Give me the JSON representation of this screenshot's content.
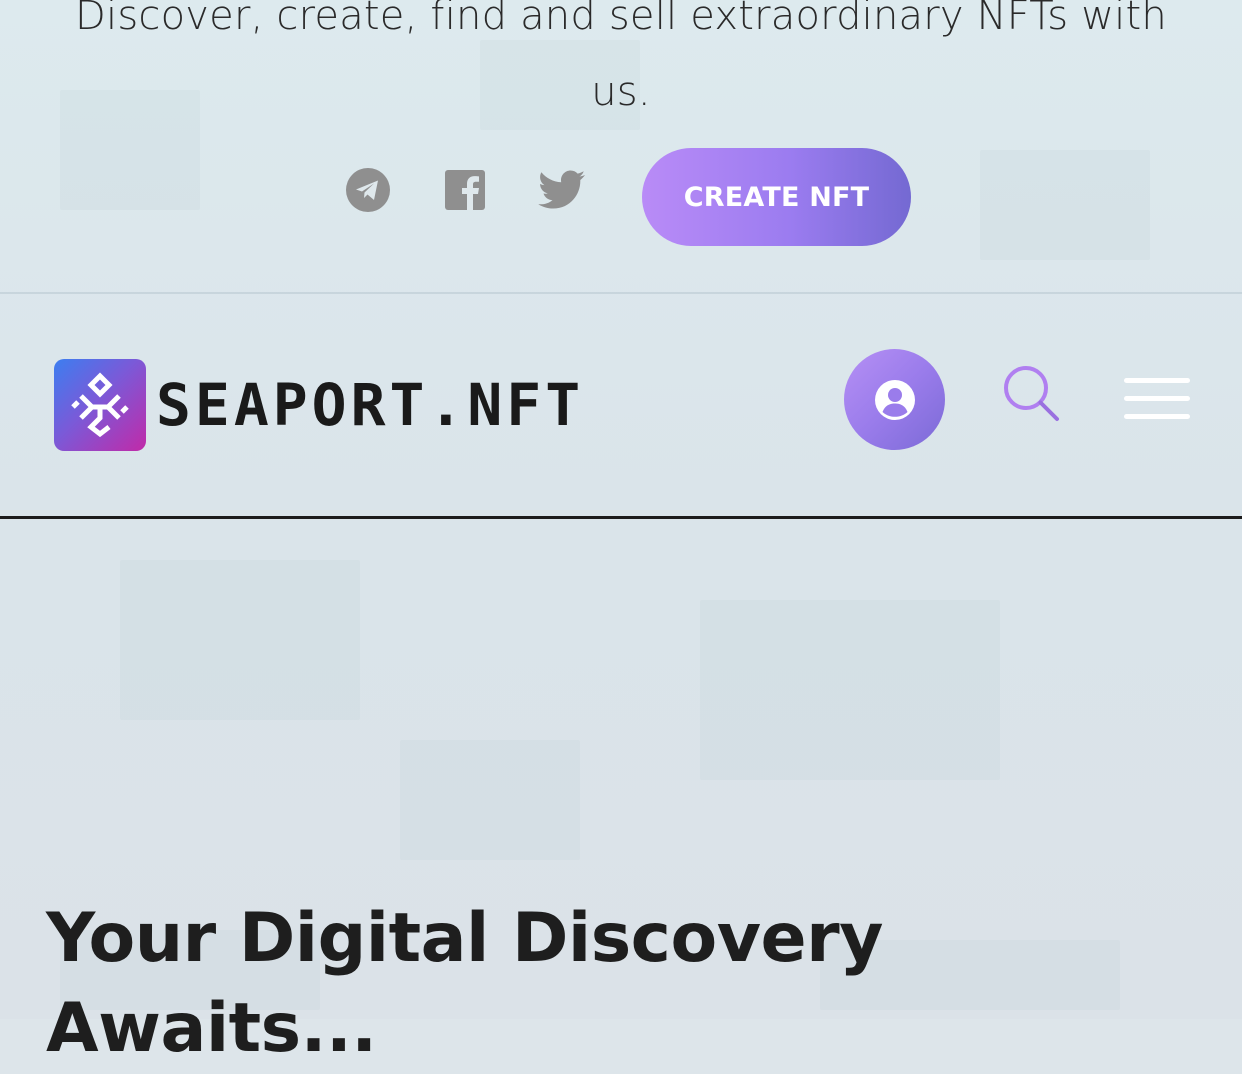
{
  "hero": {
    "tagline": "Discover, create, find and sell extraordinary NFTs with us.",
    "social": [
      {
        "name": "telegram-icon"
      },
      {
        "name": "facebook-icon"
      },
      {
        "name": "twitter-icon"
      }
    ],
    "create_button_label": "CREATE NFT"
  },
  "header": {
    "logo_text": "SEAPORT.NFT",
    "user_icon": "user-circle-icon",
    "search_icon": "search-icon",
    "menu_icon": "hamburger-menu-icon"
  },
  "main": {
    "headline": "Your Digital Discovery Awaits..."
  },
  "colors": {
    "accent_start": "#b98bf7",
    "accent_end": "#7469d2",
    "social_icon": "#8f8f8f",
    "text_dark": "#1e1e1e"
  }
}
